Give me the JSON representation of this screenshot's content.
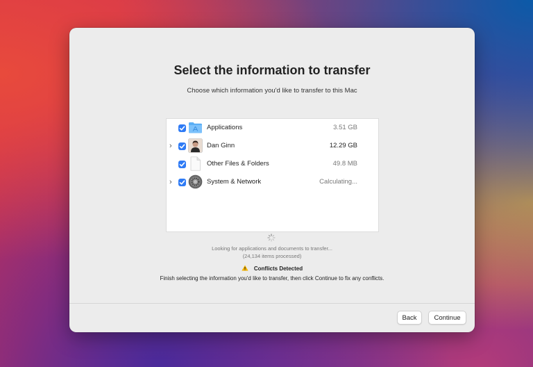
{
  "dialog": {
    "title": "Select the information to transfer",
    "subtitle": "Choose which information you'd like to transfer to this Mac"
  },
  "items": [
    {
      "label": "Applications",
      "size": "3.51 GB",
      "checked": true,
      "expandable": false,
      "icon": "folder-icon"
    },
    {
      "label": "Dan Ginn",
      "size": "12.29 GB",
      "checked": true,
      "expandable": true,
      "icon": "user-photo-icon"
    },
    {
      "label": "Other Files & Folders",
      "size": "49.8 MB",
      "checked": true,
      "expandable": false,
      "icon": "document-icon"
    },
    {
      "label": "System & Network",
      "size": "Calculating...",
      "checked": true,
      "expandable": true,
      "icon": "system-gear-icon"
    }
  ],
  "status": {
    "line1": "Looking for applications and documents to transfer...",
    "line2": "(24,134 items processed)"
  },
  "conflicts": {
    "heading": "Conflicts Detected",
    "message": "Finish selecting the information you'd like to transfer, then click Continue to fix any conflicts."
  },
  "buttons": {
    "back": "Back",
    "continue": "Continue"
  },
  "colors": {
    "accent": "#2f7bf5",
    "annotation_arrow": "#e8140c",
    "warning": "#f5b400"
  }
}
